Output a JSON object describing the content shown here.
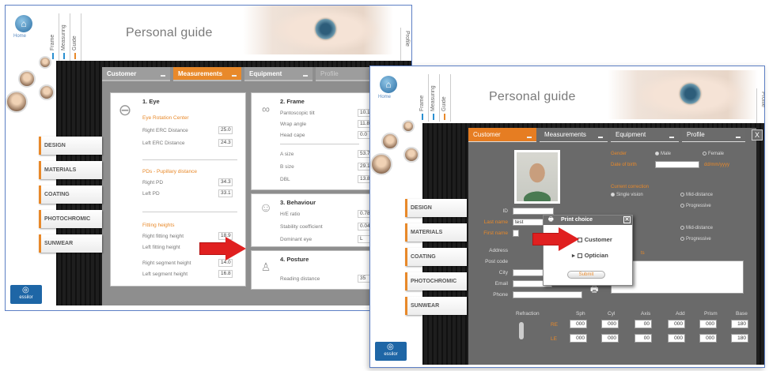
{
  "colors": {
    "accent": "#e8892a",
    "frame_border": "#5c7fc4",
    "brand": "#1e66a6",
    "arrow": "#e02020"
  },
  "shared": {
    "home_label": "Home",
    "vtabs": [
      "Frame",
      "Measuring",
      "Guide"
    ],
    "app_title": "Personal guide",
    "profile_tab": "Profile",
    "brand": "essilor",
    "menu": [
      "DESIGN",
      "MATERIALS",
      "COATING",
      "PHOTOCHROMIC",
      "SUNWEAR"
    ]
  },
  "screen1": {
    "tabs": [
      "Customer",
      "Measurements",
      "Equipment",
      "Profile"
    ],
    "eye_panel": {
      "title": "1. Eye",
      "section1": "Eye Rotation Center",
      "rows1": [
        {
          "label": "Right ERC Distance",
          "value": "25.0"
        },
        {
          "label": "Left ERC Distance",
          "value": "24.3"
        }
      ],
      "section2": "PDs - Pupillary distance",
      "rows2": [
        {
          "label": "Right PD",
          "value": "34.3"
        },
        {
          "label": "Left PD",
          "value": "33.1"
        }
      ],
      "section3": "Fitting heights",
      "rows3": [
        {
          "label": "Right fitting height",
          "value": "18.9"
        },
        {
          "label": "Left fitting height",
          "value": ""
        },
        {
          "label": "Right segment height",
          "value": "14.0"
        },
        {
          "label": "Left segment height",
          "value": "16.8"
        }
      ]
    },
    "frame_panel": {
      "title": "2. Frame",
      "rows1": [
        {
          "label": "Pantoscopic tilt",
          "value": "10.1"
        },
        {
          "label": "Wrap angle",
          "value": "11.8"
        },
        {
          "label": "Head cape",
          "value": "0.0"
        }
      ],
      "rows2": [
        {
          "label": "A size",
          "value": "53.7"
        },
        {
          "label": "B size",
          "value": "29.1"
        },
        {
          "label": "DBL",
          "value": "13.8"
        }
      ]
    },
    "behaviour_panel": {
      "title": "3. Behaviour",
      "rows": [
        {
          "label": "H/E ratio",
          "value": "0.78"
        },
        {
          "label": "Stability coefficient",
          "value": "0.04"
        },
        {
          "label": "Dominant eye",
          "value": "L"
        }
      ]
    },
    "posture_panel": {
      "title": "4. Posture",
      "rows": [
        {
          "label": "Reading distance",
          "value": "35"
        }
      ]
    }
  },
  "screen2": {
    "tabs": [
      "Customer",
      "Measurements",
      "Equipment",
      "Profile"
    ],
    "close": "X",
    "form_labels": [
      "ID",
      "Last name",
      "First name",
      "Address",
      "Post code",
      "City",
      "Email",
      "Phone"
    ],
    "last_name_value": "test",
    "right": {
      "gender_label": "Gender",
      "male": "Male",
      "female": "Female",
      "dob_label": "Date of birth",
      "dob_hint": "dd/mm/yyyy",
      "current_correction": "Current correction",
      "single_vision": "Single vision",
      "mid_distance": "Mid-distance",
      "progressive": "Progressive",
      "comments": "ts"
    },
    "dialog": {
      "title": "Print choice",
      "options": [
        "Customer",
        "Optician"
      ],
      "submit": "Submit"
    },
    "refraction": {
      "label": "Refraction",
      "headers": [
        "Sph",
        "Cyl",
        "Axis",
        "Add",
        "Prism",
        "Base"
      ],
      "rows": [
        {
          "eye": "RE",
          "values": [
            "000",
            "000",
            "00",
            "000",
            "000",
            "180"
          ]
        },
        {
          "eye": "LE",
          "values": [
            "000",
            "000",
            "00",
            "000",
            "000",
            "180"
          ]
        }
      ]
    }
  }
}
